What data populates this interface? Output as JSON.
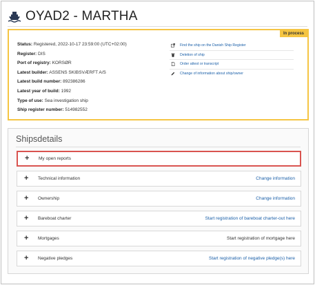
{
  "header": {
    "title": "OYAD2 - MARTHA",
    "icon": "ship-icon"
  },
  "info": {
    "badge": "In process",
    "rows": [
      {
        "label": "Status:",
        "value": "Registered, 2022-10-17 23:59:00 (UTC+02:00)"
      },
      {
        "label": "Register:",
        "value": "DIS"
      },
      {
        "label": "Port of registry:",
        "value": "KORSØR"
      },
      {
        "label": "Latest builder:",
        "value": "ASSENS SKIBSVÆRFT A/S"
      },
      {
        "label": "Latest build number:",
        "value": "892386286"
      },
      {
        "label": "Latest year of build:",
        "value": "1992"
      },
      {
        "label": "Type of use:",
        "value": "Sea investigation ship"
      },
      {
        "label": "Ship register number:",
        "value": "514982552"
      }
    ],
    "actions": [
      {
        "label": "Find the ship on the Danish Ship Register",
        "icon": "external-link-icon"
      },
      {
        "label": "Deletion of ship",
        "icon": "trash-icon"
      },
      {
        "label": "Order attest or transcript",
        "icon": "document-icon"
      },
      {
        "label": "Change of information about ship/owner",
        "icon": "pencil-icon"
      }
    ]
  },
  "shipsdetails": {
    "title": "Shipsdetails",
    "sections": [
      {
        "label": "My open reports",
        "link": ""
      },
      {
        "label": "Technical information",
        "link": "Change information"
      },
      {
        "label": "Ownership",
        "link": "Change information"
      },
      {
        "label": "Bareboat charter",
        "link": "Start registration of bareboat charter-out here"
      },
      {
        "label": "Mortgages",
        "link": "Start registration of mortgage here"
      },
      {
        "label": "Negative pledges",
        "link": "Start registration of negative pledge(s) here"
      }
    ]
  },
  "colors": {
    "accent": "#f5c542",
    "link": "#1a5fa8",
    "highlight": "#d9534f"
  }
}
